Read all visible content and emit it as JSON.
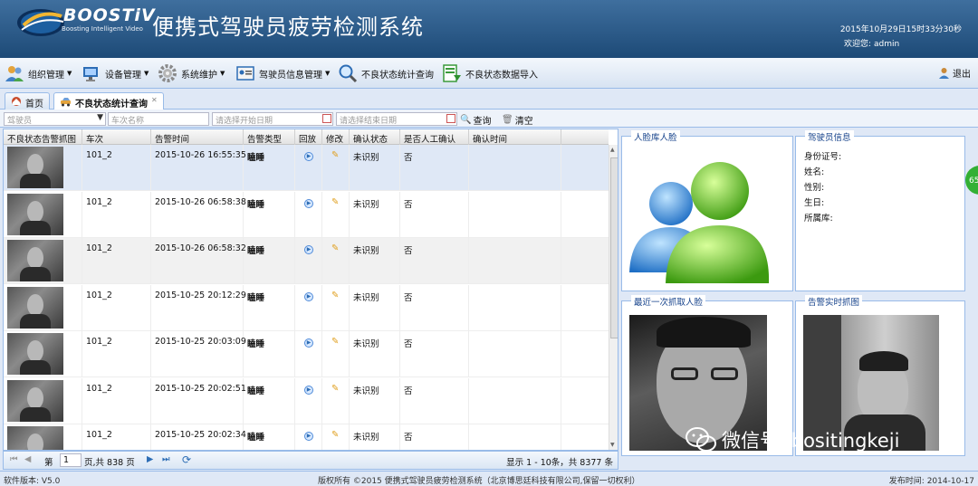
{
  "header": {
    "logo_text": "BOOSTiV",
    "logo_subtitle": "Boosting Intelligent Video",
    "app_title": "便携式驾驶员疲劳检测系统",
    "datetime": "2015年10月29日15时33分30秒",
    "welcome_label": "欢迎您:",
    "username": "admin"
  },
  "toolbar": {
    "items": [
      {
        "label": "组织管理",
        "icon": "users-icon",
        "dropdown": true
      },
      {
        "label": "设备管理",
        "icon": "device-icon",
        "dropdown": true
      },
      {
        "label": "系统维护",
        "icon": "gear-icon",
        "dropdown": true
      },
      {
        "label": "驾驶员信息管理",
        "icon": "id-card-icon",
        "dropdown": true
      },
      {
        "label": "不良状态统计查询",
        "icon": "search-icon",
        "dropdown": false
      },
      {
        "label": "不良状态数据导入",
        "icon": "import-icon",
        "dropdown": false
      }
    ],
    "logout": "退出"
  },
  "tabs": [
    {
      "label": "首页",
      "active": false
    },
    {
      "label": "不良状态统计查询",
      "active": true
    }
  ],
  "filters": {
    "driver_placeholder": "驾驶员",
    "train_placeholder": "车次名称",
    "start_placeholder": "请选择开始日期",
    "end_placeholder": "请选择结束日期",
    "query_label": "查询",
    "clear_label": "清空"
  },
  "grid": {
    "columns": [
      "不良状态告警抓图",
      "车次",
      "告警时间",
      "告警类型",
      "回放",
      "修改",
      "确认状态",
      "是否人工确认",
      "确认时间"
    ],
    "rows": [
      {
        "train": "101_2",
        "time": "2015-10-26 16:55:35",
        "type": "瞌睡",
        "status": "未识别",
        "manual": "否",
        "confirm_time": ""
      },
      {
        "train": "101_2",
        "time": "2015-10-26 06:58:38",
        "type": "瞌睡",
        "status": "未识别",
        "manual": "否",
        "confirm_time": ""
      },
      {
        "train": "101_2",
        "time": "2015-10-26 06:58:32",
        "type": "瞌睡",
        "status": "未识别",
        "manual": "否",
        "confirm_time": ""
      },
      {
        "train": "101_2",
        "time": "2015-10-25 20:12:29",
        "type": "瞌睡",
        "status": "未识别",
        "manual": "否",
        "confirm_time": ""
      },
      {
        "train": "101_2",
        "time": "2015-10-25 20:03:09",
        "type": "瞌睡",
        "status": "未识别",
        "manual": "否",
        "confirm_time": ""
      },
      {
        "train": "101_2",
        "time": "2015-10-25 20:02:51",
        "type": "瞌睡",
        "status": "未识别",
        "manual": "否",
        "confirm_time": ""
      },
      {
        "train": "101_2",
        "time": "2015-10-25 20:02:34",
        "type": "瞌睡",
        "status": "未识别",
        "manual": "否",
        "confirm_time": ""
      }
    ]
  },
  "pager": {
    "page_label": "第",
    "page_value": "1",
    "page_total": "页,共 838 页",
    "summary": "显示 1 - 10条，共 8377 条"
  },
  "panels": {
    "face_library": "人脸库人脸",
    "driver_info": "驾驶员信息",
    "driver_fields": [
      "身份证号:",
      "姓名:",
      "性别:",
      "生日:",
      "所属库:"
    ],
    "last_capture": "最近一次抓取人脸",
    "realtime_capture": "告警实时抓图"
  },
  "watermark": "微信号: bositingkeji",
  "side_badge": "65",
  "footer": {
    "version": "软件版本:  V5.0",
    "copyright": "版权所有 ©2015 便携式驾驶员疲劳检测系统（北京博思廷科技有限公司,保留一切权利）",
    "release": "发布时间:  2014-10-17"
  }
}
